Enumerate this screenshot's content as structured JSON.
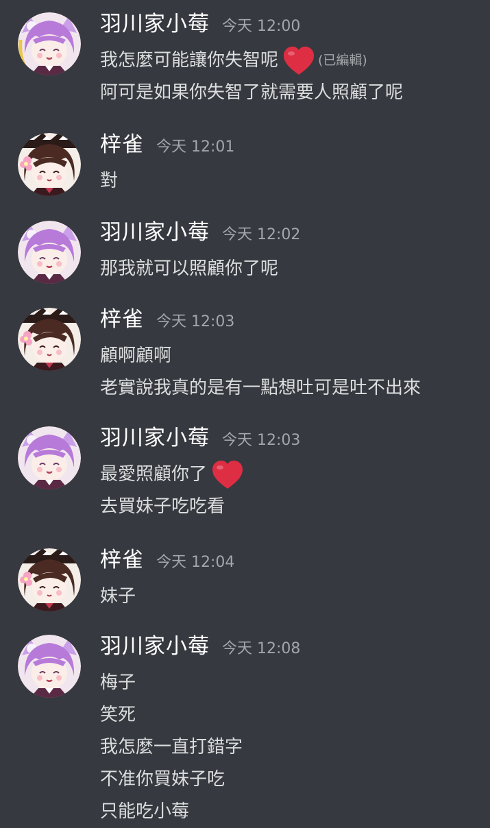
{
  "colors": {
    "background": "#36393f",
    "username": "#ffffff",
    "text": "#dcddde",
    "timestamp": "#a3a6aa",
    "heart": "#dd2e44"
  },
  "messages": [
    {
      "author": "羽川家小莓",
      "avatar": "purple-hair-avatar",
      "time": "今天 12:00",
      "lines": [
        {
          "text": "我怎麼可能讓你失智呢",
          "emoji": "red-heart-icon",
          "edited": "(已編輯)"
        },
        {
          "text": "阿可是如果你失智了就需要人照顧了呢"
        }
      ]
    },
    {
      "author": "梓雀",
      "avatar": "brown-hair-avatar",
      "time": "今天 12:01",
      "lines": [
        {
          "text": "對"
        }
      ]
    },
    {
      "author": "羽川家小莓",
      "avatar": "purple-hair-avatar",
      "time": "今天 12:02",
      "lines": [
        {
          "text": "那我就可以照顧你了呢"
        }
      ]
    },
    {
      "author": "梓雀",
      "avatar": "brown-hair-avatar",
      "time": "今天 12:03",
      "lines": [
        {
          "text": "顧啊顧啊"
        },
        {
          "text": "老實說我真的是有一點想吐可是吐不出來"
        }
      ]
    },
    {
      "author": "羽川家小莓",
      "avatar": "purple-hair-avatar",
      "time": "今天 12:03",
      "lines": [
        {
          "text": "最愛照顧你了",
          "emoji": "red-heart-icon"
        },
        {
          "text": "去買妹子吃吃看"
        }
      ]
    },
    {
      "author": "梓雀",
      "avatar": "brown-hair-avatar",
      "time": "今天 12:04",
      "lines": [
        {
          "text": "妹子"
        }
      ]
    },
    {
      "author": "羽川家小莓",
      "avatar": "purple-hair-avatar",
      "time": "今天 12:08",
      "lines": [
        {
          "text": "梅子"
        },
        {
          "text": "笑死"
        },
        {
          "text": "我怎麼一直打錯字"
        },
        {
          "text": "不准你買妹子吃"
        },
        {
          "text": "只能吃小莓"
        }
      ]
    }
  ]
}
